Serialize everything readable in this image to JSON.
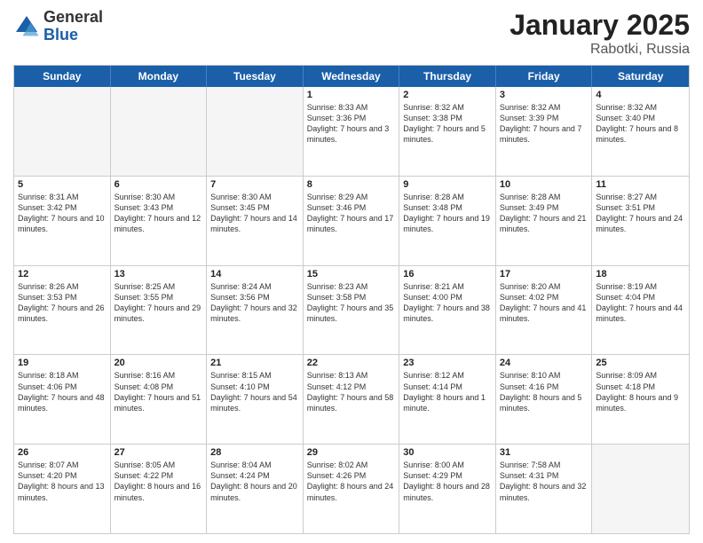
{
  "logo": {
    "general": "General",
    "blue": "Blue"
  },
  "title": "January 2025",
  "location": "Rabotki, Russia",
  "header_days": [
    "Sunday",
    "Monday",
    "Tuesday",
    "Wednesday",
    "Thursday",
    "Friday",
    "Saturday"
  ],
  "weeks": [
    [
      {
        "day": "",
        "empty": true
      },
      {
        "day": "",
        "empty": true
      },
      {
        "day": "",
        "empty": true
      },
      {
        "day": "1",
        "text": "Sunrise: 8:33 AM\nSunset: 3:36 PM\nDaylight: 7 hours\nand 3 minutes."
      },
      {
        "day": "2",
        "text": "Sunrise: 8:32 AM\nSunset: 3:38 PM\nDaylight: 7 hours\nand 5 minutes."
      },
      {
        "day": "3",
        "text": "Sunrise: 8:32 AM\nSunset: 3:39 PM\nDaylight: 7 hours\nand 7 minutes."
      },
      {
        "day": "4",
        "text": "Sunrise: 8:32 AM\nSunset: 3:40 PM\nDaylight: 7 hours\nand 8 minutes."
      }
    ],
    [
      {
        "day": "5",
        "text": "Sunrise: 8:31 AM\nSunset: 3:42 PM\nDaylight: 7 hours\nand 10 minutes."
      },
      {
        "day": "6",
        "text": "Sunrise: 8:30 AM\nSunset: 3:43 PM\nDaylight: 7 hours\nand 12 minutes."
      },
      {
        "day": "7",
        "text": "Sunrise: 8:30 AM\nSunset: 3:45 PM\nDaylight: 7 hours\nand 14 minutes."
      },
      {
        "day": "8",
        "text": "Sunrise: 8:29 AM\nSunset: 3:46 PM\nDaylight: 7 hours\nand 17 minutes."
      },
      {
        "day": "9",
        "text": "Sunrise: 8:28 AM\nSunset: 3:48 PM\nDaylight: 7 hours\nand 19 minutes."
      },
      {
        "day": "10",
        "text": "Sunrise: 8:28 AM\nSunset: 3:49 PM\nDaylight: 7 hours\nand 21 minutes."
      },
      {
        "day": "11",
        "text": "Sunrise: 8:27 AM\nSunset: 3:51 PM\nDaylight: 7 hours\nand 24 minutes."
      }
    ],
    [
      {
        "day": "12",
        "text": "Sunrise: 8:26 AM\nSunset: 3:53 PM\nDaylight: 7 hours\nand 26 minutes."
      },
      {
        "day": "13",
        "text": "Sunrise: 8:25 AM\nSunset: 3:55 PM\nDaylight: 7 hours\nand 29 minutes."
      },
      {
        "day": "14",
        "text": "Sunrise: 8:24 AM\nSunset: 3:56 PM\nDaylight: 7 hours\nand 32 minutes."
      },
      {
        "day": "15",
        "text": "Sunrise: 8:23 AM\nSunset: 3:58 PM\nDaylight: 7 hours\nand 35 minutes."
      },
      {
        "day": "16",
        "text": "Sunrise: 8:21 AM\nSunset: 4:00 PM\nDaylight: 7 hours\nand 38 minutes."
      },
      {
        "day": "17",
        "text": "Sunrise: 8:20 AM\nSunset: 4:02 PM\nDaylight: 7 hours\nand 41 minutes."
      },
      {
        "day": "18",
        "text": "Sunrise: 8:19 AM\nSunset: 4:04 PM\nDaylight: 7 hours\nand 44 minutes."
      }
    ],
    [
      {
        "day": "19",
        "text": "Sunrise: 8:18 AM\nSunset: 4:06 PM\nDaylight: 7 hours\nand 48 minutes."
      },
      {
        "day": "20",
        "text": "Sunrise: 8:16 AM\nSunset: 4:08 PM\nDaylight: 7 hours\nand 51 minutes."
      },
      {
        "day": "21",
        "text": "Sunrise: 8:15 AM\nSunset: 4:10 PM\nDaylight: 7 hours\nand 54 minutes."
      },
      {
        "day": "22",
        "text": "Sunrise: 8:13 AM\nSunset: 4:12 PM\nDaylight: 7 hours\nand 58 minutes."
      },
      {
        "day": "23",
        "text": "Sunrise: 8:12 AM\nSunset: 4:14 PM\nDaylight: 8 hours\nand 1 minute."
      },
      {
        "day": "24",
        "text": "Sunrise: 8:10 AM\nSunset: 4:16 PM\nDaylight: 8 hours\nand 5 minutes."
      },
      {
        "day": "25",
        "text": "Sunrise: 8:09 AM\nSunset: 4:18 PM\nDaylight: 8 hours\nand 9 minutes."
      }
    ],
    [
      {
        "day": "26",
        "text": "Sunrise: 8:07 AM\nSunset: 4:20 PM\nDaylight: 8 hours\nand 13 minutes."
      },
      {
        "day": "27",
        "text": "Sunrise: 8:05 AM\nSunset: 4:22 PM\nDaylight: 8 hours\nand 16 minutes."
      },
      {
        "day": "28",
        "text": "Sunrise: 8:04 AM\nSunset: 4:24 PM\nDaylight: 8 hours\nand 20 minutes."
      },
      {
        "day": "29",
        "text": "Sunrise: 8:02 AM\nSunset: 4:26 PM\nDaylight: 8 hours\nand 24 minutes."
      },
      {
        "day": "30",
        "text": "Sunrise: 8:00 AM\nSunset: 4:29 PM\nDaylight: 8 hours\nand 28 minutes."
      },
      {
        "day": "31",
        "text": "Sunrise: 7:58 AM\nSunset: 4:31 PM\nDaylight: 8 hours\nand 32 minutes."
      },
      {
        "day": "",
        "empty": true
      }
    ]
  ]
}
